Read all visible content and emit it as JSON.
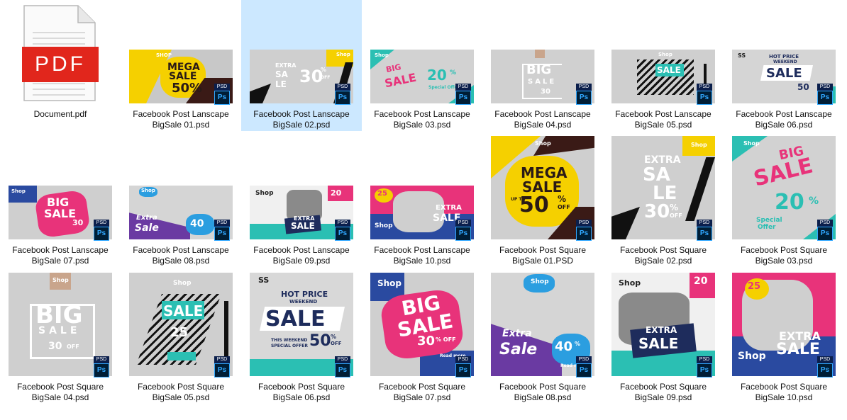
{
  "badge": {
    "psd": "PSD",
    "ps": "Ps"
  },
  "files": [
    {
      "name": "Document.pdf",
      "pdf_label": "PDF"
    },
    {
      "line1": "Facebook Post Lanscape",
      "line2": "BigSale 01.psd",
      "art": [
        "SHOP",
        "MEGA",
        "SALE",
        "50%"
      ]
    },
    {
      "line1": "Facebook Post Lanscape",
      "line2": "BigSale 02.psd",
      "art": [
        "EXTRA",
        "SA",
        "LE",
        "30",
        "%",
        "OFF",
        "Shop"
      ]
    },
    {
      "line1": "Facebook Post Lanscape",
      "line2": "BigSale 03.psd",
      "art": [
        "Shop",
        "BIG",
        "SALE",
        "20",
        "%",
        "Special Offer"
      ]
    },
    {
      "line1": "Facebook Post Lanscape",
      "line2": "BigSale 04.psd",
      "art": [
        "BIG",
        "SALE",
        "30"
      ]
    },
    {
      "line1": "Facebook Post Lanscape",
      "line2": "BigSale 05.psd",
      "art": [
        "Shop",
        "SALE"
      ]
    },
    {
      "line1": "Facebook Post Lanscape",
      "line2": "BigSale 06.psd",
      "art": [
        "SS",
        "HOT PRICE",
        "WEEKEND",
        "SALE",
        "50"
      ]
    },
    {
      "line1": "Facebook Post Lanscape",
      "line2": "BigSale 07.psd",
      "art": [
        "Shop",
        "BIG",
        "SALE",
        "30"
      ]
    },
    {
      "line1": "Facebook Post Lanscape",
      "line2": "BigSale 08.psd",
      "art": [
        "Shop",
        "Extra",
        "Sale",
        "40"
      ]
    },
    {
      "line1": "Facebook Post Lanscape",
      "line2": "BigSale 09.psd",
      "art": [
        "Shop",
        "20",
        "EXTRA",
        "SALE"
      ]
    },
    {
      "line1": "Facebook Post Lanscape",
      "line2": "BigSale 10.psd",
      "art": [
        "25",
        "Shop",
        "EXTRA",
        "SALE"
      ]
    },
    {
      "line1": "Facebook Post Square",
      "line2": "BigSale 01.PSD",
      "art": [
        "Shop",
        "MEGA",
        "SALE",
        "UP TO",
        "50",
        "%",
        "OFF"
      ]
    },
    {
      "line1": "Facebook Post Square",
      "line2": "BigSale 02.psd",
      "art": [
        "Shop",
        "EXTRA",
        "SA",
        "LE",
        "30",
        "%",
        "OFF"
      ]
    },
    {
      "line1": "Facebook Post Square",
      "line2": "BigSale 03.psd",
      "art": [
        "Shop",
        "BIG",
        "SALE",
        "20",
        "%",
        "Special",
        "Offer"
      ]
    },
    {
      "line1": "Facebook Post Square",
      "line2": "BigSale 04.psd",
      "art": [
        "Shop",
        "BIG",
        "SALE",
        "30",
        "OFF"
      ]
    },
    {
      "line1": "Facebook Post Square",
      "line2": "BigSale 05.psd",
      "art": [
        "Shop",
        "SALE",
        "25"
      ]
    },
    {
      "line1": "Facebook Post Square",
      "line2": "BigSale 06.psd",
      "art": [
        "SS",
        "HOT PRICE",
        "WEEKEND",
        "SALE",
        "THIS WEEKEND",
        "SPECIAL OFFER",
        "50",
        "%",
        "OFF"
      ]
    },
    {
      "line1": "Facebook Post Square",
      "line2": "BigSale 07.psd",
      "art": [
        "Shop",
        "BIG",
        "SALE",
        "30",
        "% OFF",
        "Read more"
      ]
    },
    {
      "line1": "Facebook Post Square",
      "line2": "BigSale 08.psd",
      "art": [
        "Shop",
        "Extra",
        "Sale",
        "40",
        "%",
        "Read more"
      ]
    },
    {
      "line1": "Facebook Post Square",
      "line2": "BigSale 09.psd",
      "art": [
        "Shop",
        "20",
        "EXTRA",
        "SALE"
      ]
    },
    {
      "line1": "Facebook Post Square",
      "line2": "BigSale 10.psd",
      "art": [
        "25",
        "Shop",
        "EXTRA",
        "SALE"
      ]
    }
  ]
}
